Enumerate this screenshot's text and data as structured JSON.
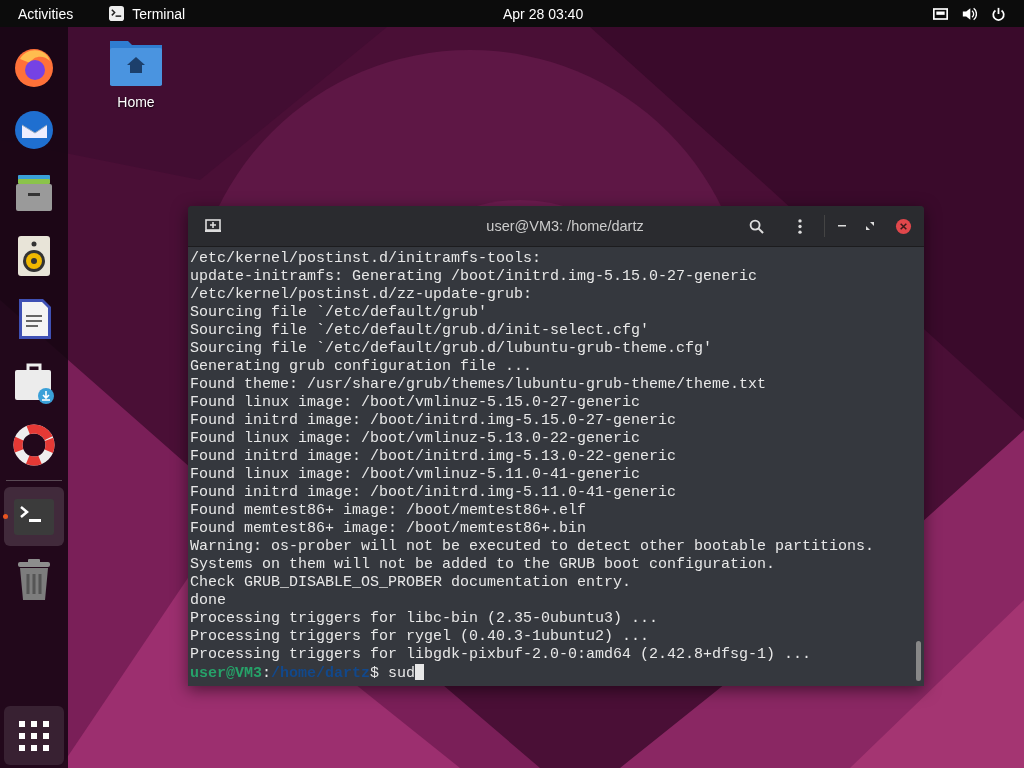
{
  "top_bar": {
    "activities": "Activities",
    "app_name": "Terminal",
    "clock": "Apr 28  03:40"
  },
  "dock": {
    "items": [
      {
        "kind": "browser",
        "selected": false,
        "running": false
      },
      {
        "kind": "mail",
        "selected": false,
        "running": false
      },
      {
        "kind": "files",
        "selected": false,
        "running": false
      },
      {
        "kind": "music",
        "selected": false,
        "running": false
      },
      {
        "kind": "writer",
        "selected": false,
        "running": false
      },
      {
        "kind": "software",
        "selected": false,
        "running": false
      },
      {
        "kind": "help",
        "selected": false,
        "running": false
      },
      {
        "kind": "terminal",
        "selected": true,
        "running": true
      },
      {
        "kind": "trash",
        "selected": false,
        "running": false
      }
    ]
  },
  "desktop_icons": [
    {
      "label": "Home"
    }
  ],
  "terminal": {
    "title": "user@VM3: /home/dartz",
    "lines": [
      "/etc/kernel/postinst.d/initramfs-tools:",
      "update-initramfs: Generating /boot/initrd.img-5.15.0-27-generic",
      "/etc/kernel/postinst.d/zz-update-grub:",
      "Sourcing file `/etc/default/grub'",
      "Sourcing file `/etc/default/grub.d/init-select.cfg'",
      "Sourcing file `/etc/default/grub.d/lubuntu-grub-theme.cfg'",
      "Generating grub configuration file ...",
      "Found theme: /usr/share/grub/themes/lubuntu-grub-theme/theme.txt",
      "Found linux image: /boot/vmlinuz-5.15.0-27-generic",
      "Found initrd image: /boot/initrd.img-5.15.0-27-generic",
      "Found linux image: /boot/vmlinuz-5.13.0-22-generic",
      "Found initrd image: /boot/initrd.img-5.13.0-22-generic",
      "Found linux image: /boot/vmlinuz-5.11.0-41-generic",
      "Found initrd image: /boot/initrd.img-5.11.0-41-generic",
      "Found memtest86+ image: /boot/memtest86+.elf",
      "Found memtest86+ image: /boot/memtest86+.bin",
      "Warning: os-prober will not be executed to detect other bootable partitions.",
      "Systems on them will not be added to the GRUB boot configuration.",
      "Check GRUB_DISABLE_OS_PROBER documentation entry.",
      "done",
      "Processing triggers for libc-bin (2.35-0ubuntu3) ...",
      "Processing triggers for rygel (0.40.3-1ubuntu2) ...",
      "Processing triggers for libgdk-pixbuf-2.0-0:amd64 (2.42.8+dfsg-1) ..."
    ],
    "prompt": {
      "user_host": "user@VM3",
      "separator": ":",
      "path": "/home/dartz",
      "symbol": "$",
      "input": "sud"
    }
  }
}
